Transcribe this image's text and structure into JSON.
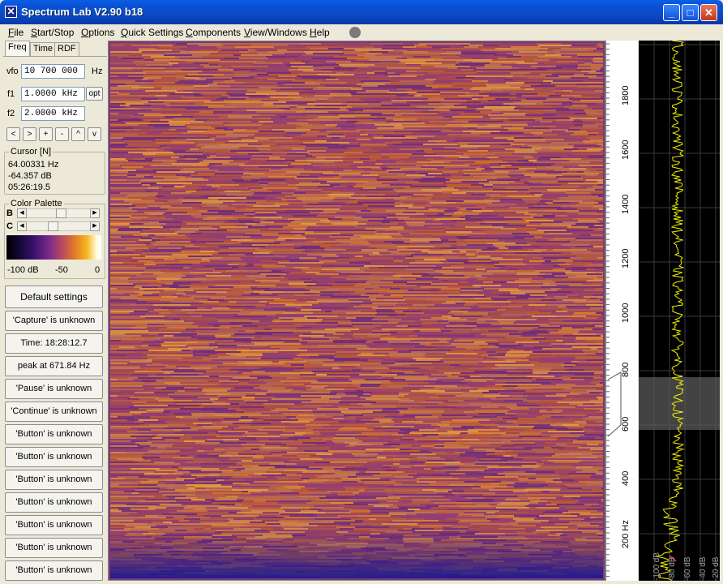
{
  "window": {
    "title": "Spectrum Lab V2.90 b18",
    "min_label": "_",
    "max_label": "□",
    "close_label": "✕"
  },
  "menu": [
    {
      "u": "F",
      "rest": "ile"
    },
    {
      "u": "S",
      "rest": "tart/Stop"
    },
    {
      "u": "O",
      "rest": "ptions"
    },
    {
      "u": "Q",
      "rest": "uick Settings"
    },
    {
      "u": "C",
      "rest": "omponents"
    },
    {
      "u": "V",
      "rest": "iew/Windows"
    },
    {
      "u": "H",
      "rest": "elp"
    }
  ],
  "tabs": [
    "Freq",
    "Time",
    "RDF"
  ],
  "freq": {
    "vfo_label": "vfo",
    "vfo_value": "10 700 000",
    "vfo_unit": "Hz",
    "f1_label": "f1",
    "f1_value": "1.0000 kHz",
    "f1_opt": "opt",
    "f2_label": "f2",
    "f2_value": "2.0000 kHz",
    "nav_buttons": [
      "<",
      ">",
      "+",
      "-",
      "^",
      "v"
    ]
  },
  "cursor": {
    "title": "Cursor [N]",
    "freq": "64.00331 Hz",
    "level": "-64.357 dB",
    "time": "05:26:19.5"
  },
  "palette": {
    "title": "Color Palette",
    "b_label": "B",
    "c_label": "C",
    "b_level": 0.56,
    "c_level": 0.4,
    "scale_min": "-100 dB",
    "scale_mid": "-50",
    "scale_max": "0"
  },
  "buttons": [
    "Default settings",
    "'Capture' is unknown",
    "Time:  18:28:12.7",
    "peak at 671.84 Hz",
    "'Pause' is unknown",
    "'Continue' is unknown",
    "'Button' is unknown",
    "'Button' is unknown",
    "'Button' is unknown",
    "'Button' is unknown",
    "'Button' is unknown",
    "'Button' is unknown",
    "'Button' is unknown"
  ],
  "freq_axis": {
    "ticks": [
      "1800",
      "1600",
      "1400",
      "1200",
      "1000",
      "800",
      "600",
      "400",
      "200 Hz"
    ]
  },
  "spectrum_axis": {
    "db_labels": [
      "-100 dB",
      "-80 dB",
      "-60 dB",
      "-40 dB",
      "-20 dB"
    ]
  },
  "colors": {
    "titlebar": "#0a4ac4",
    "waterfall_base": "#7a3878",
    "waterfall_hot": "#f7b820",
    "spectrum_trace": "#f0f000",
    "spectrum_bg": "#000000"
  }
}
